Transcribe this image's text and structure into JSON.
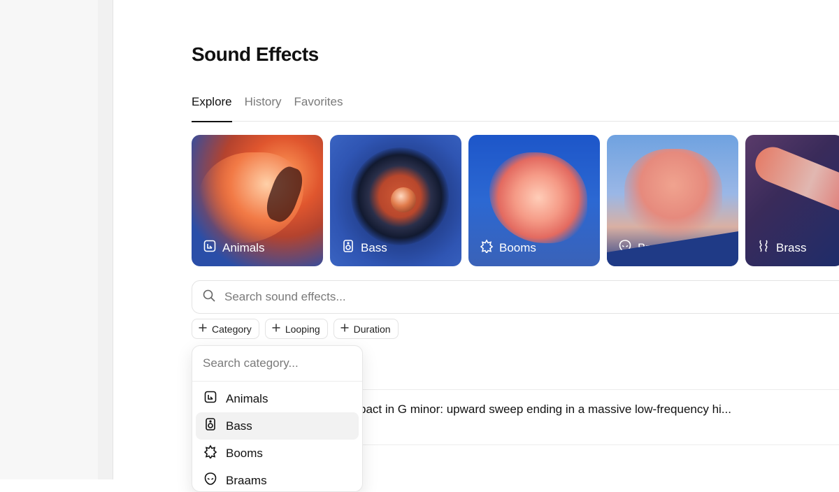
{
  "page": {
    "title": "Sound Effects"
  },
  "tabs": [
    {
      "label": "Explore",
      "active": true
    },
    {
      "label": "History",
      "active": false
    },
    {
      "label": "Favorites",
      "active": false
    }
  ],
  "categories": [
    {
      "label": "Animals",
      "icon": "animal-tile-icon"
    },
    {
      "label": "Bass",
      "icon": "speaker-icon"
    },
    {
      "label": "Booms",
      "icon": "burst-icon"
    },
    {
      "label": "Braams",
      "icon": "alien-head-icon"
    },
    {
      "label": "Brass",
      "icon": "brass-wave-icon"
    }
  ],
  "search": {
    "placeholder": "Search sound effects..."
  },
  "filters": [
    {
      "label": "Category",
      "icon": "plus-icon"
    },
    {
      "label": "Looping",
      "icon": "plus-icon"
    },
    {
      "label": "Duration",
      "icon": "plus-icon"
    }
  ],
  "results": [
    {
      "text": "pact in G minor: upward sweep ending in a massive low-frequency hi..."
    }
  ],
  "category_dropdown": {
    "placeholder": "Search category...",
    "items": [
      {
        "label": "Animals",
        "icon": "animal-tile-icon",
        "highlighted": false
      },
      {
        "label": "Bass",
        "icon": "speaker-icon",
        "highlighted": true
      },
      {
        "label": "Booms",
        "icon": "burst-icon",
        "highlighted": false
      },
      {
        "label": "Braams",
        "icon": "alien-head-icon",
        "highlighted": false
      }
    ]
  }
}
